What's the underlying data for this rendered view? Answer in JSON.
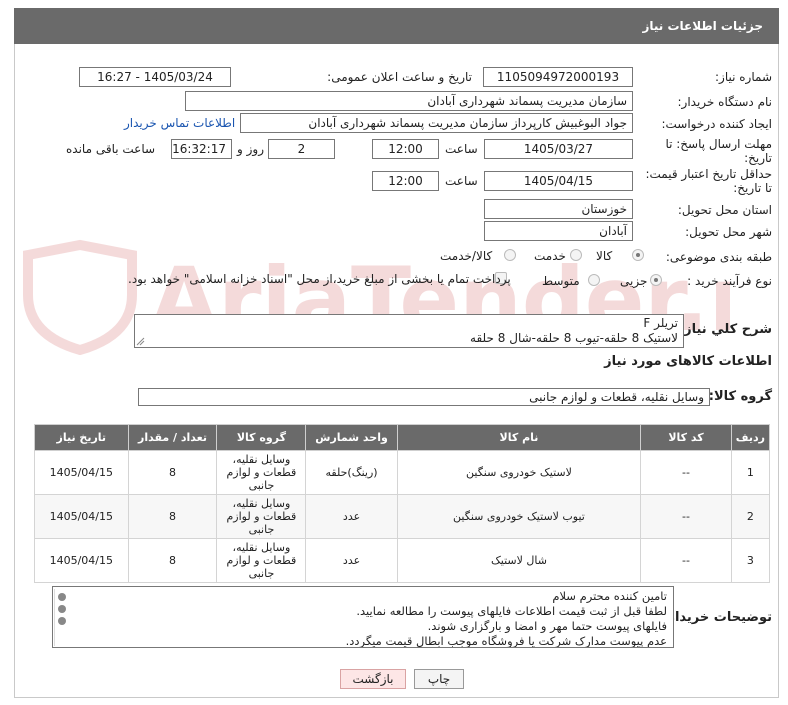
{
  "header": {
    "title": "جزئیات اطلاعات نیاز"
  },
  "labels": {
    "need_number": "شماره نیاز:",
    "announce_datetime": "تاریخ و ساعت اعلان عمومی:",
    "buyer_org": "نام دستگاه خریدار:",
    "requester": "ایجاد کننده درخواست:",
    "reply_deadline_1": "مهلت ارسال پاسخ: تا",
    "reply_deadline_2": "تاریخ:",
    "price_validity_1": "حداقل تاریخ اعتبار قیمت:",
    "price_validity_2": "تا تاریخ:",
    "hour": "ساعت",
    "day_and": "روز و",
    "hours_remaining": "ساعت باقی مانده",
    "province": "استان محل تحویل:",
    "city": "شهر محل تحویل:",
    "category": "طبقه بندی موضوعی:",
    "process_type": "نوع فرآیند خرید :",
    "general_desc": "شرح کلي نياز:",
    "goods_info": "اطلاعات کالاهای مورد نیاز",
    "goods_group": "گروه کالا:",
    "buyer_notes": "توضیحات خریدار:"
  },
  "fields": {
    "need_number": "1105094972000193",
    "announce_datetime": "1405/03/24 - 16:27",
    "buyer_org": "سازمان مدیریت پسماند شهرداری آبادان",
    "requester": "جواد البوغبیش کارپرداز سازمان مدیریت پسماند شهرداری آبادان",
    "contact_link": "اطلاعات تماس خریدار",
    "reply_date": "1405/03/27",
    "reply_time": "12:00",
    "days": "2",
    "remaining": "16:32:17",
    "validity_date": "1405/04/15",
    "validity_time": "12:00",
    "province": "خوزستان",
    "city": "آبادان",
    "general_desc_line1": "تریلر F",
    "general_desc_line2": "لاستیک 8 حلقه-تیوب 8 حلقه-شال 8 حلقه",
    "goods_group": "وسایل نقلیه، قطعات و لوازم جانبی"
  },
  "category_options": {
    "goods": "کالا",
    "service": "خدمت",
    "goods_service": "کالا/خدمت",
    "selected": "کالا"
  },
  "process_options": {
    "minor": "جزیی",
    "medium": "متوسط",
    "selected": "جزیی",
    "treasury_note": "پرداخت تمام یا بخشی از مبلغ خرید،از محل \"اسناد خزانه اسلامی\" خواهد بود."
  },
  "table": {
    "headers": [
      "ردیف",
      "کد کالا",
      "نام کالا",
      "واحد شمارش",
      "گروه کالا",
      "تعداد / مقدار",
      "تاریخ نیاز"
    ],
    "rows": [
      [
        "1",
        "--",
        "لاستیک خودروی سنگین",
        "(رینگ)حلقه",
        "وسایل نقلیه، قطعات و لوازم جانبی",
        "8",
        "1405/04/15"
      ],
      [
        "2",
        "--",
        "تیوب لاستیک خودروی سنگین",
        "عدد",
        "وسایل نقلیه، قطعات و لوازم جانبی",
        "8",
        "1405/04/15"
      ],
      [
        "3",
        "--",
        "شال لاستیک",
        "عدد",
        "وسایل نقلیه، قطعات و لوازم جانبی",
        "8",
        "1405/04/15"
      ]
    ]
  },
  "notes": [
    "تامین کننده محترم سلام",
    "لطفا قبل از ثبت قیمت اطلاعات فایلهای پیوست را مطالعه نمایید.",
    "فایلهای پیوست حتما مهر و امضا و بارگزاری شوند.",
    "عدم پیوست مدارک شرکت یا فروشگاه موجب ابطال قیمت میگردد."
  ],
  "buttons": {
    "print": "چاپ",
    "back": "بازگشت"
  },
  "watermark": {
    "text": "AriaTender.net"
  },
  "colors": {
    "header_bg": "#6a6a6a",
    "link": "#1a55b0",
    "back_button_bg": "#fde6e6",
    "watermark": "#c43a3a"
  }
}
